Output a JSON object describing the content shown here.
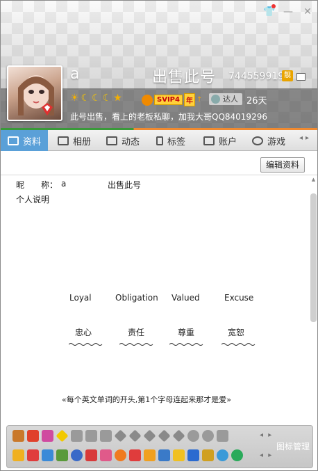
{
  "window": {
    "skin_icon": "shirt-icon",
    "minimize_icon": "minimize-icon",
    "close_icon": "close-icon"
  },
  "profile": {
    "nickname": "a",
    "sale_title": "出售此号",
    "qq_number": "744559919",
    "vip_icon_text": "靓",
    "level_icons": [
      "sun",
      "moon",
      "moon",
      "moon",
      "star"
    ],
    "svip_label": "SVIP4",
    "year_label": "年",
    "talent_label": "达人",
    "days": "26天",
    "signature": "此号出售，看上的老板私聊，加我大哥QQ84019296"
  },
  "tabs": [
    {
      "label": "资料",
      "icon": "id-card-icon"
    },
    {
      "label": "相册",
      "icon": "photo-icon"
    },
    {
      "label": "动态",
      "icon": "list-icon"
    },
    {
      "label": "标签",
      "icon": "bookmark-icon"
    },
    {
      "label": "账户",
      "icon": "briefcase-icon"
    },
    {
      "label": "游戏",
      "icon": "game-icon"
    }
  ],
  "content": {
    "edit_button": "编辑资料",
    "nick_label": "昵　　称：",
    "nick_value": "a",
    "nick_value_2": "出售此号",
    "bio_label": "个人说明",
    "english_words": [
      "Loyal",
      "Obligation",
      "Valued",
      "Excuse"
    ],
    "chinese_words": [
      "忠心",
      "责任",
      "尊重",
      "宽恕"
    ],
    "tagline": "«每个英文单词的开头,第1个字母连起来那才是爱»"
  },
  "icon_bar": {
    "manage_label": "图标管理",
    "arrows": "◂ ▸"
  },
  "colors": {
    "tab_active": "#5aa0d8",
    "accent_green": "#3a9a3a",
    "accent_orange": "#f08a30",
    "svip_yellow": "#ffd13b"
  }
}
